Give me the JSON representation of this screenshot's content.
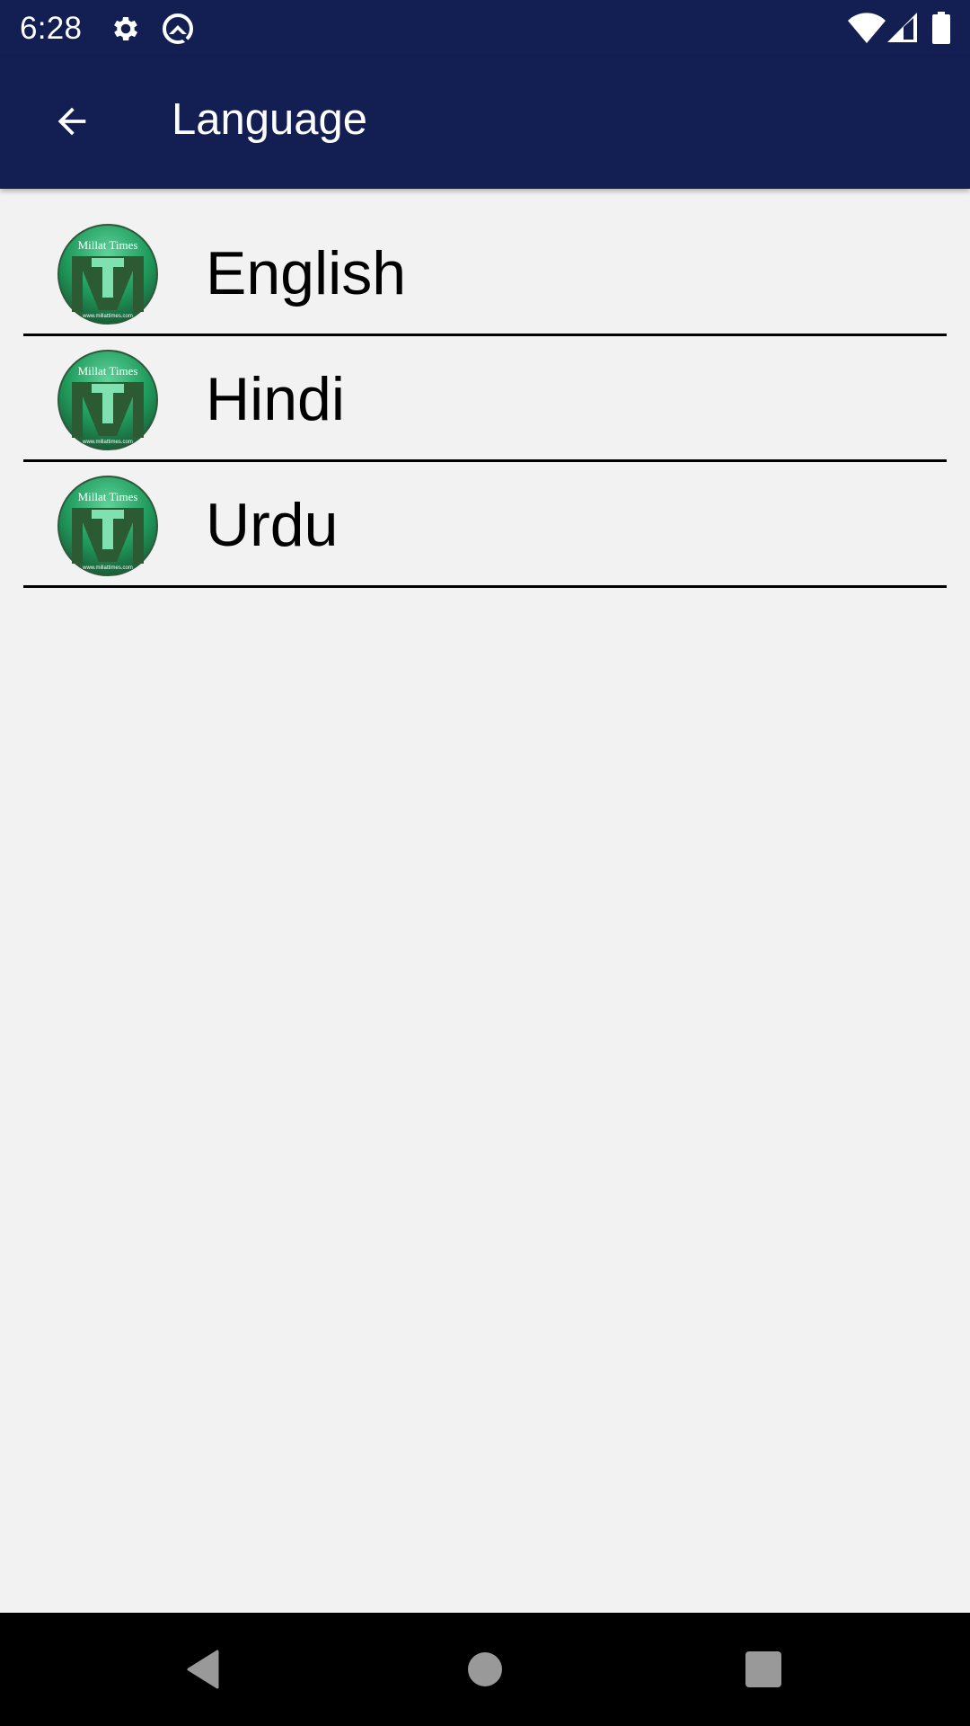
{
  "status_bar": {
    "time": "6:28",
    "left_icons": [
      "gear-icon",
      "q-icon"
    ],
    "right_icons": [
      "wifi-icon",
      "signal-icon",
      "battery-icon"
    ]
  },
  "app_bar": {
    "back_icon": "arrow-left-icon",
    "title": "Language",
    "background_color": "#131f52"
  },
  "languages": [
    {
      "label": "English",
      "icon": "millat-times-logo",
      "logo_text": "Millat Times"
    },
    {
      "label": "Hindi",
      "icon": "millat-times-logo",
      "logo_text": "Millat Times"
    },
    {
      "label": "Urdu",
      "icon": "millat-times-logo",
      "logo_text": "Millat Times"
    }
  ],
  "nav_bar": {
    "buttons": [
      "back-triangle-icon",
      "home-circle-icon",
      "recents-square-icon"
    ]
  }
}
